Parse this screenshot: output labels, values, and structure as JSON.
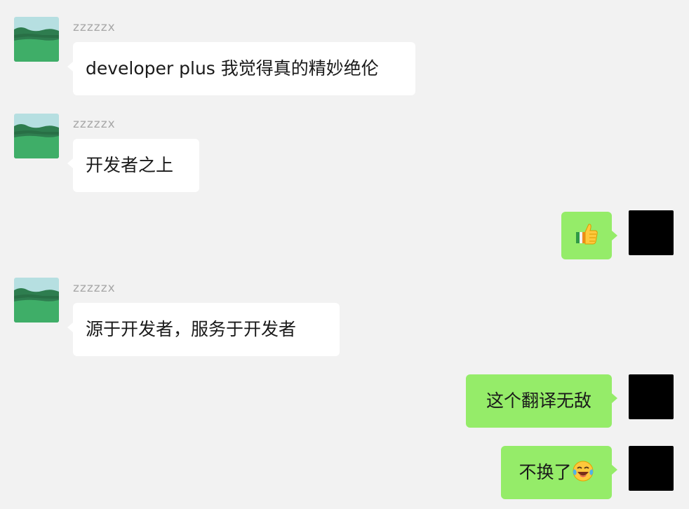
{
  "chat": {
    "messages": [
      {
        "side": "in",
        "sender": "zzzzzx",
        "text": "developer plus 我觉得真的精妙绝伦"
      },
      {
        "side": "in",
        "sender": "zzzzzx",
        "text": "开发者之上"
      },
      {
        "side": "out",
        "text": "",
        "emoji": "thumbs-up-emoji"
      },
      {
        "side": "in",
        "sender": "zzzzzx",
        "text": "源于开发者，服务于开发者"
      },
      {
        "side": "out",
        "text": "这个翻译无敌"
      },
      {
        "side": "out",
        "text": "不换了",
        "emoji": "laughing-crying-emoji"
      }
    ]
  },
  "colors": {
    "background": "#f2f2f2",
    "incoming_bubble": "#ffffff",
    "outgoing_bubble": "#95ec69",
    "sender_name": "#a7a7a7",
    "self_avatar": "#000000"
  },
  "icons": {
    "contact_avatar": "landscape-avatar",
    "self_avatar": "black-square-avatar"
  }
}
